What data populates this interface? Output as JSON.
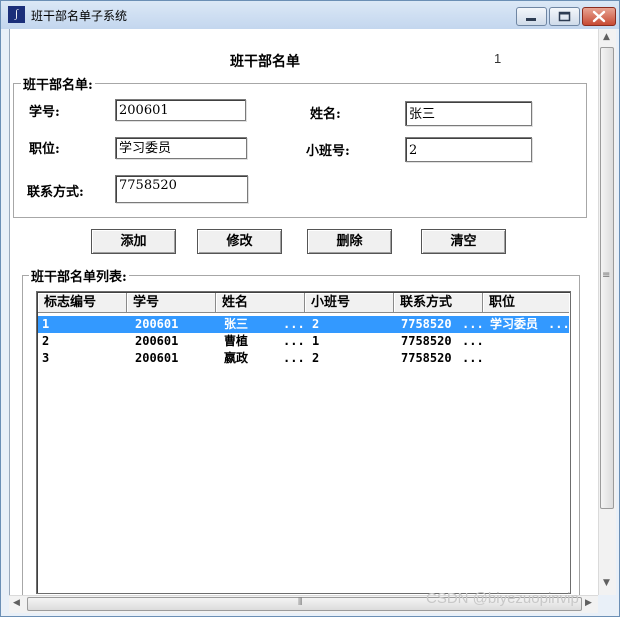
{
  "window": {
    "title": "班干部名单子系统",
    "app_icon_glyph": "∫"
  },
  "form": {
    "heading": "班干部名单",
    "record_counter": "1",
    "group_title": "班干部名单:",
    "fields": {
      "student_id": {
        "label": "学号:",
        "value": "200601"
      },
      "name": {
        "label": "姓名:",
        "value": "张三"
      },
      "position": {
        "label": "职位:",
        "value": "学习委员"
      },
      "class_no": {
        "label": "小班号:",
        "value": "2"
      },
      "contact": {
        "label": "联系方式:",
        "value": "7758520"
      }
    },
    "buttons": {
      "add": "添加",
      "edit": "修改",
      "delete": "删除",
      "clear": "清空"
    }
  },
  "list": {
    "group_title": "班干部名单列表:",
    "columns": [
      "标志编号",
      "学号",
      "姓名",
      "小班号",
      "联系方式",
      "职位"
    ],
    "rows": [
      {
        "id": "1",
        "student_id": "200601",
        "name": "张三",
        "class_no": "2",
        "contact": "7758520",
        "position": "学习委员",
        "selected": true
      },
      {
        "id": "2",
        "student_id": "200601",
        "name": "曹植",
        "class_no": "1",
        "contact": "7758520",
        "position": "",
        "selected": false
      },
      {
        "id": "3",
        "student_id": "200601",
        "name": "嬴政",
        "class_no": "2",
        "contact": "7758520",
        "position": "",
        "selected": false
      }
    ],
    "ellipsis": "..."
  },
  "colors": {
    "selection": "#3399ff",
    "titlebar": "#c3d6ee",
    "close_button": "#c74a33"
  },
  "scrollbar": {
    "grip": "≡",
    "h_grip": "⦀"
  },
  "watermark": "CSDN @biyezuopinvip"
}
